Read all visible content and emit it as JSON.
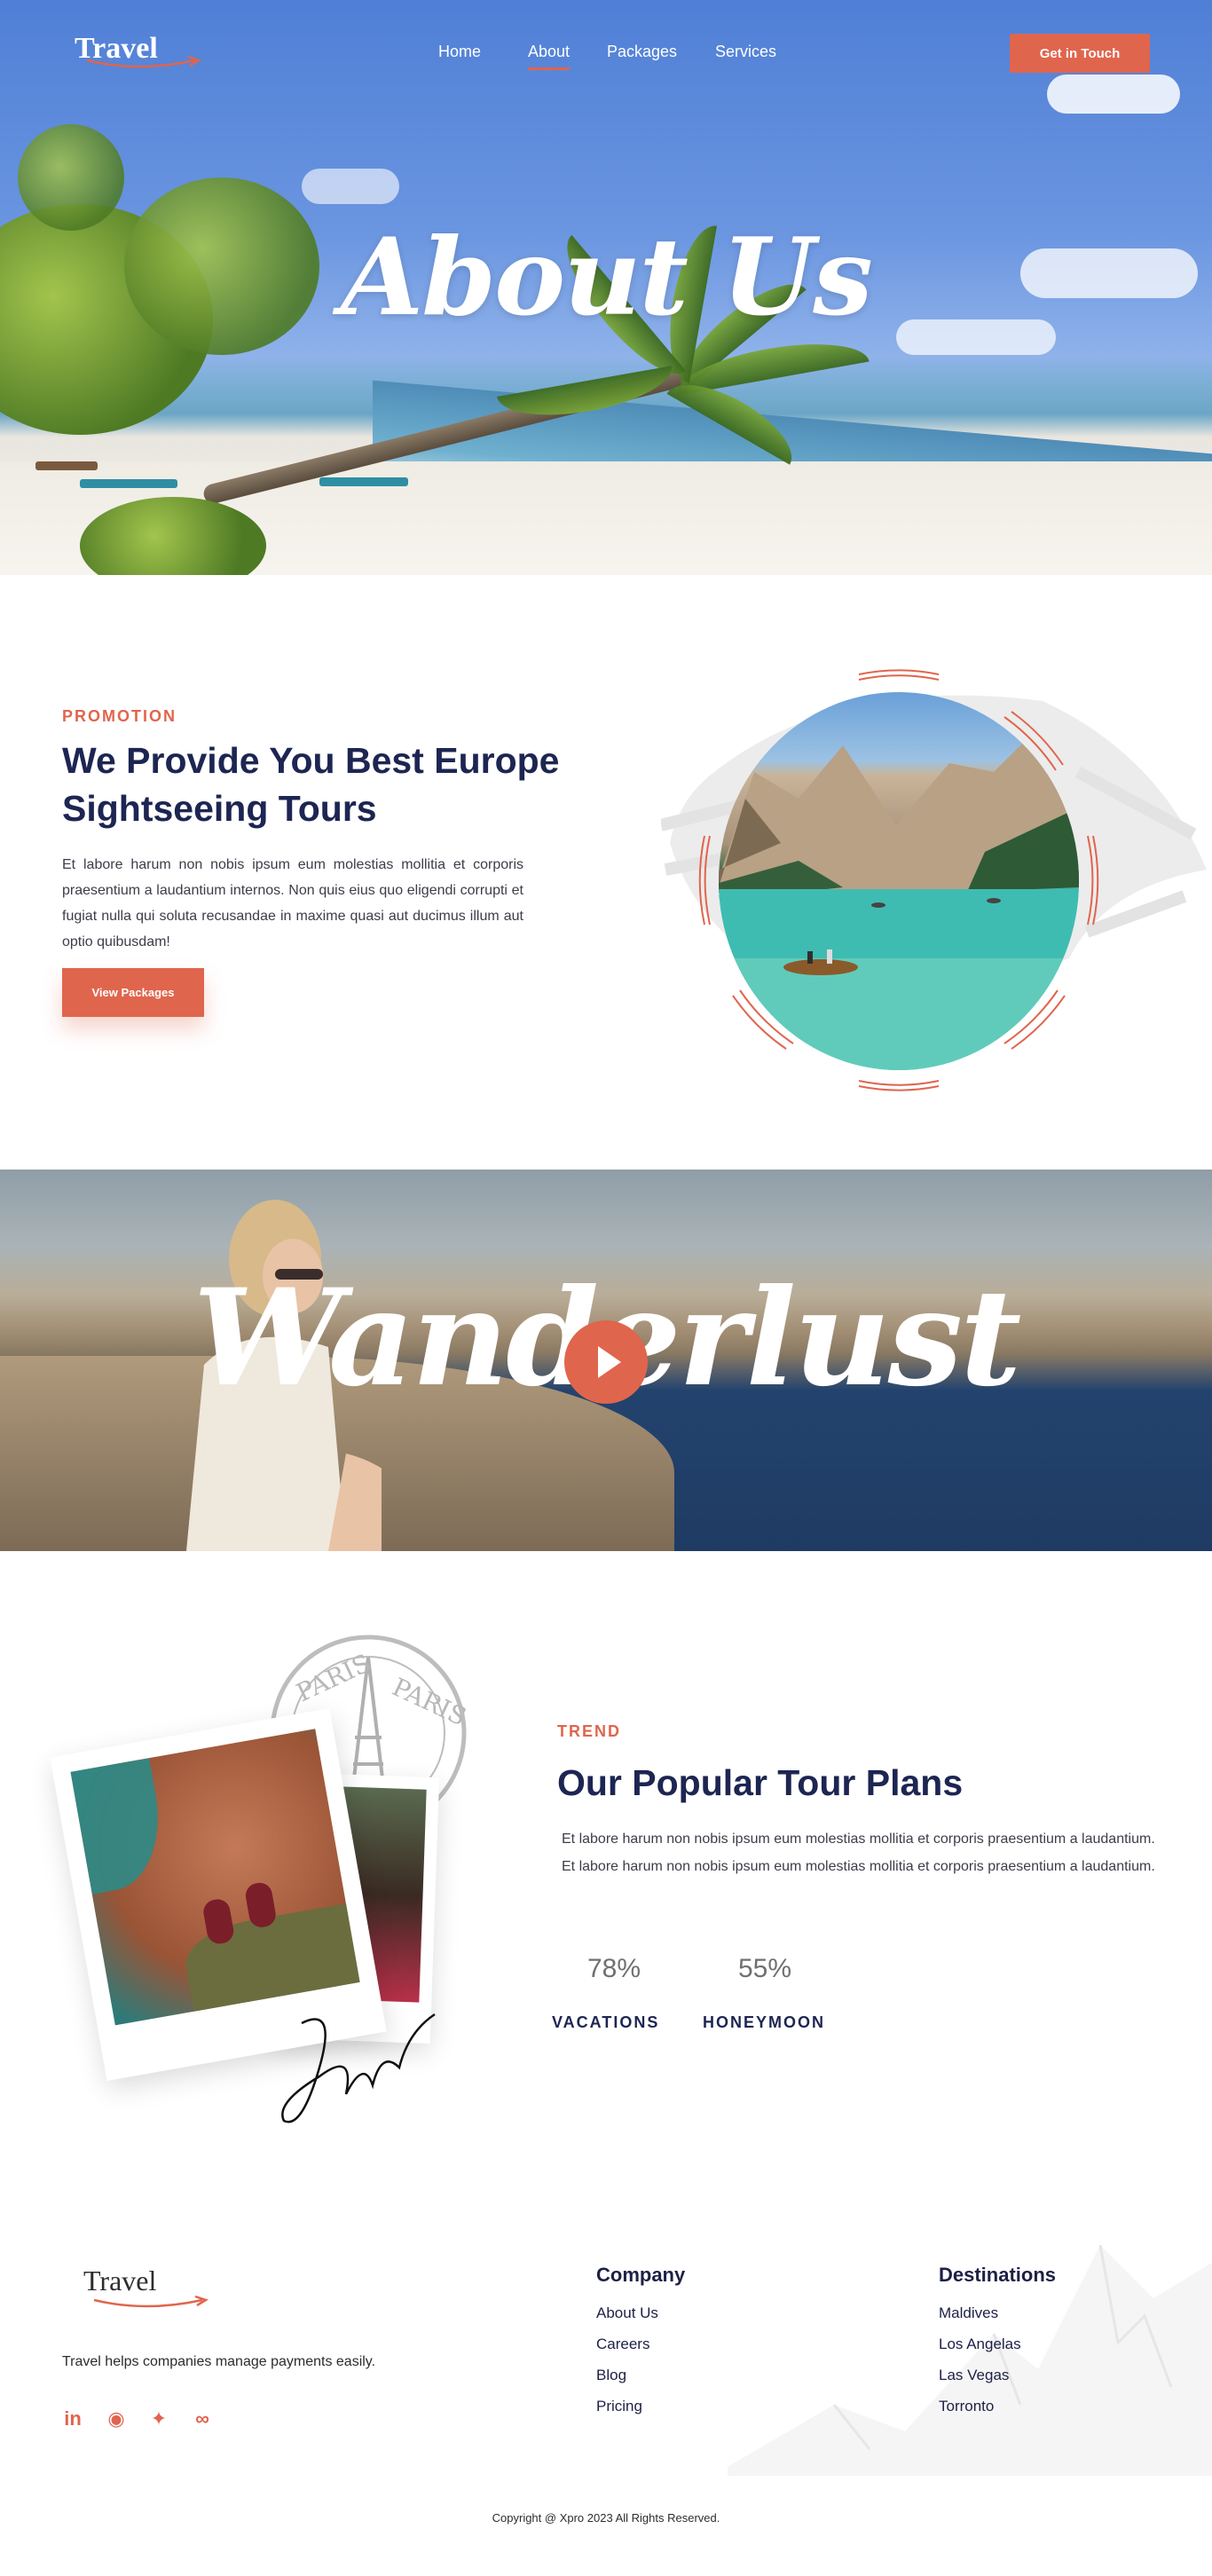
{
  "nav": {
    "logo": "Travel",
    "links": [
      {
        "label": "Home"
      },
      {
        "label": "About"
      },
      {
        "label": "Packages"
      },
      {
        "label": "Services"
      }
    ],
    "cta": "Get in Touch"
  },
  "hero": {
    "title": "About Us"
  },
  "promotion": {
    "eyebrow": "PROMOTION",
    "heading_line1": "We Provide You Best Europe",
    "heading_line2": "Sightseeing Tours",
    "body": "Et labore harum non nobis ipsum eum molestias mollitia et corporis praesentium a laudantium internos. Non quis eius quo eligendi corrupti et fugiat nulla qui soluta recusandae in maxime quasi aut ducimus illum aut optio quibusdam!",
    "button": "View Packages"
  },
  "wanderlust": {
    "title": "Wanderlust"
  },
  "trend": {
    "eyebrow": "TREND",
    "heading": "Our Popular Tour Plans",
    "body": "Et labore harum non nobis ipsum eum molestias mollitia et corporis praesentium a laudantium. Et labore harum non nobis ipsum eum molestias mollitia et corporis praesentium a laudantium.",
    "stats": [
      {
        "value": "78%",
        "label": "VACATIONS"
      },
      {
        "value": "55%",
        "label": "HONEYMOON"
      }
    ]
  },
  "footer": {
    "logo": "Travel",
    "description": "Travel helps companies manage payments easily.",
    "social": [
      {
        "icon": "linkedin-icon",
        "glyph": "in"
      },
      {
        "icon": "messenger-icon",
        "glyph": "◉"
      },
      {
        "icon": "twitter-icon",
        "glyph": "✦"
      },
      {
        "icon": "link-icon",
        "glyph": "∞"
      }
    ],
    "company": {
      "title": "Company",
      "links": [
        "About Us",
        "Careers",
        "Blog",
        "Pricing"
      ]
    },
    "destinations": {
      "title": "Destinations",
      "links": [
        "Maldives",
        "Los Angelas",
        "Las Vegas",
        "Torronto"
      ]
    },
    "copyright": "Copyright @ Xpro 2023 All Rights Reserved."
  },
  "colors": {
    "accent": "#e0654d",
    "navy": "#1d2552"
  }
}
